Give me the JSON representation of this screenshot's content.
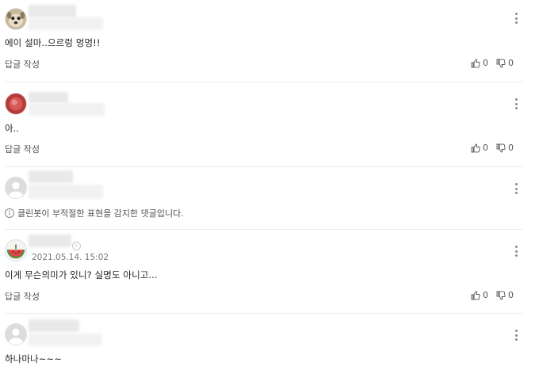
{
  "comments": [
    {
      "text": "에이 설마..으르렁 멍멍!!",
      "reply_label": "답글 작성",
      "likes": "0",
      "dislikes": "0",
      "avatar": "dog-avatar"
    },
    {
      "text": "아..",
      "reply_label": "답글 작성",
      "likes": "0",
      "dislikes": "0",
      "avatar": "red-avatar"
    },
    {
      "notice": "클린봇이 부적절한 표현을 감지한 댓글입니다.",
      "avatar": "default-avatar"
    },
    {
      "date": "2021.05.14. 15:02",
      "text": "이게 무슨의미가 있니? 실명도 아니고...",
      "reply_label": "답글 작성",
      "likes": "0",
      "dislikes": "0",
      "avatar": "watermelon-avatar"
    },
    {
      "text": "하나마나~~~",
      "avatar": "default-avatar"
    }
  ],
  "icons": {
    "like": "thumbs-up-icon",
    "dislike": "thumbs-down-icon",
    "more": "more-vertical-icon",
    "info": "info-icon"
  }
}
